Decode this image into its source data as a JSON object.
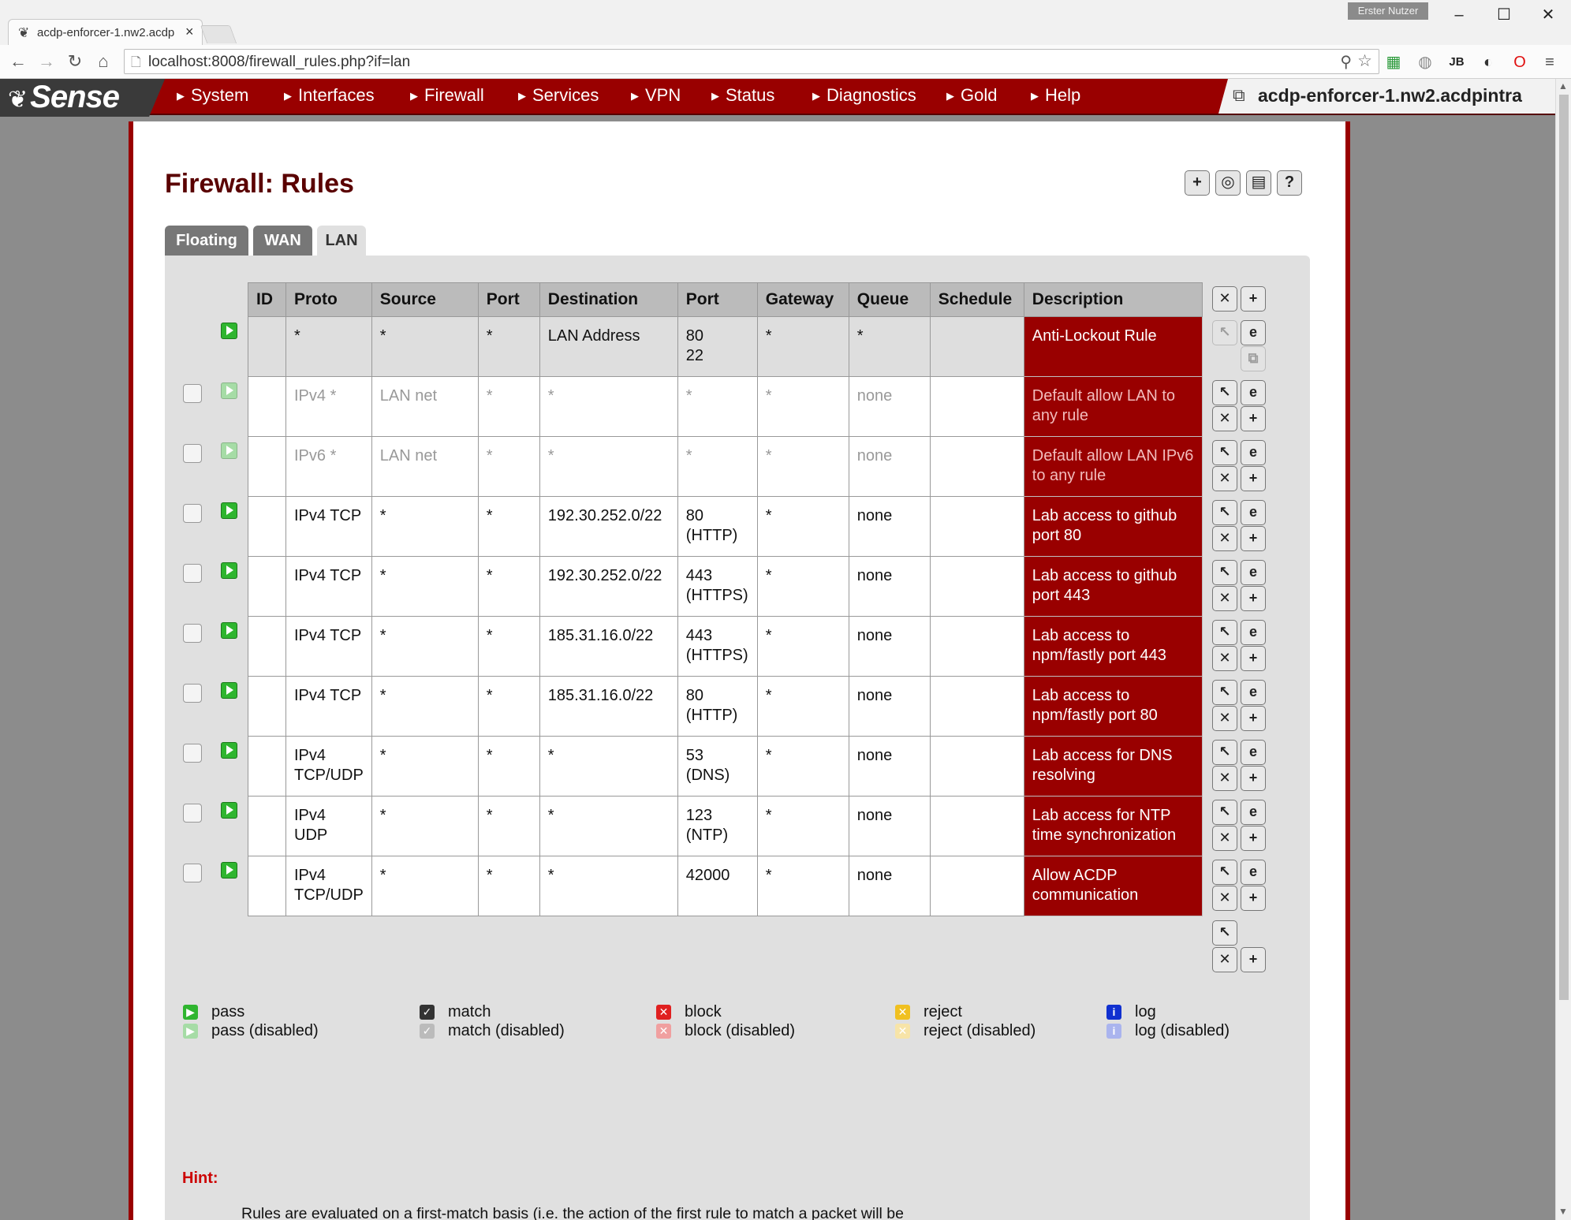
{
  "browser": {
    "tab_title": "acdp-enforcer-1.nw2.acdp",
    "url": "localhost:8008/firewall_rules.php?if=lan",
    "user_badge": "Erster Nutzer"
  },
  "nav": {
    "logo": "Sense",
    "items": [
      "System",
      "Interfaces",
      "Firewall",
      "Services",
      "VPN",
      "Status",
      "Diagnostics",
      "Gold",
      "Help"
    ],
    "hostname": "acdp-enforcer-1.nw2.acdpintra"
  },
  "page": {
    "title": "Firewall: Rules",
    "tabs": [
      "Floating",
      "WAN",
      "LAN"
    ],
    "active_tab": "LAN"
  },
  "table": {
    "headers": [
      "ID",
      "Proto",
      "Source",
      "Port",
      "Destination",
      "Port",
      "Gateway",
      "Queue",
      "Schedule",
      "Description"
    ],
    "rows": [
      {
        "id": "",
        "proto": "*",
        "source": "*",
        "sport": "*",
        "destination": "LAN Address",
        "dport": "80\n22",
        "gateway": "*",
        "queue": "*",
        "schedule": "",
        "description": "Anti-Lockout Rule",
        "enabled": true,
        "anti": true
      },
      {
        "id": "",
        "proto": "IPv4 *",
        "source": "LAN net",
        "sport": "*",
        "destination": "*",
        "dport": "*",
        "gateway": "*",
        "queue": "none",
        "schedule": "",
        "description": "Default allow LAN to any rule",
        "enabled": false
      },
      {
        "id": "",
        "proto": "IPv6 *",
        "source": "LAN net",
        "sport": "*",
        "destination": "*",
        "dport": "*",
        "gateway": "*",
        "queue": "none",
        "schedule": "",
        "description": "Default allow LAN IPv6 to any rule",
        "enabled": false
      },
      {
        "id": "",
        "proto": "IPv4 TCP",
        "source": "*",
        "sport": "*",
        "destination": "192.30.252.0/22",
        "dport": "80\n(HTTP)",
        "gateway": "*",
        "queue": "none",
        "schedule": "",
        "description": "Lab access to github port 80",
        "enabled": true
      },
      {
        "id": "",
        "proto": "IPv4 TCP",
        "source": "*",
        "sport": "*",
        "destination": "192.30.252.0/22",
        "dport": "443\n(HTTPS)",
        "gateway": "*",
        "queue": "none",
        "schedule": "",
        "description": "Lab access to github port 443",
        "enabled": true
      },
      {
        "id": "",
        "proto": "IPv4 TCP",
        "source": "*",
        "sport": "*",
        "destination": "185.31.16.0/22",
        "dport": "443\n(HTTPS)",
        "gateway": "*",
        "queue": "none",
        "schedule": "",
        "description": "Lab access to npm/fastly port 443",
        "enabled": true
      },
      {
        "id": "",
        "proto": "IPv4 TCP",
        "source": "*",
        "sport": "*",
        "destination": "185.31.16.0/22",
        "dport": "80\n(HTTP)",
        "gateway": "*",
        "queue": "none",
        "schedule": "",
        "description": "Lab access to npm/fastly port 80",
        "enabled": true
      },
      {
        "id": "",
        "proto": "IPv4\nTCP/UDP",
        "source": "*",
        "sport": "*",
        "destination": "*",
        "dport": "53\n(DNS)",
        "gateway": "*",
        "queue": "none",
        "schedule": "",
        "description": "Lab access for DNS resolving",
        "enabled": true
      },
      {
        "id": "",
        "proto": "IPv4\nUDP",
        "source": "*",
        "sport": "*",
        "destination": "*",
        "dport": "123\n(NTP)",
        "gateway": "*",
        "queue": "none",
        "schedule": "",
        "description": "Lab access for NTP time synchronization",
        "enabled": true
      },
      {
        "id": "",
        "proto": "IPv4\nTCP/UDP",
        "source": "*",
        "sport": "*",
        "destination": "*",
        "dport": "42000",
        "gateway": "*",
        "queue": "none",
        "schedule": "",
        "description": "Allow ACDP communication",
        "enabled": true
      }
    ]
  },
  "legend": [
    {
      "label": "pass",
      "label_disabled": "pass (disabled)",
      "color": "#2fb52f",
      "color_disabled": "#a6dca6",
      "glyph": "▶"
    },
    {
      "label": "match",
      "label_disabled": "match (disabled)",
      "color": "#333333",
      "color_disabled": "#bbbbbb",
      "glyph": "✓"
    },
    {
      "label": "block",
      "label_disabled": "block (disabled)",
      "color": "#e02020",
      "color_disabled": "#f0a0a0",
      "glyph": "✕"
    },
    {
      "label": "reject",
      "label_disabled": "reject (disabled)",
      "color": "#f0c020",
      "color_disabled": "#f7e4a8",
      "glyph": "✕"
    },
    {
      "label": "log",
      "label_disabled": "log (disabled)",
      "color": "#1030d0",
      "color_disabled": "#aab4ee",
      "glyph": "i"
    }
  ],
  "hint": {
    "label": "Hint:",
    "text": "Rules are evaluated on a first-match basis (i.e. the action of the first rule to match a packet will be executed). This means that if you use block rules, you'll have to pay attention to the rule order. Everything that isn't explicitly passed is blocked by default."
  },
  "colors": {
    "brand": "#990000",
    "title": "#5a0000"
  }
}
